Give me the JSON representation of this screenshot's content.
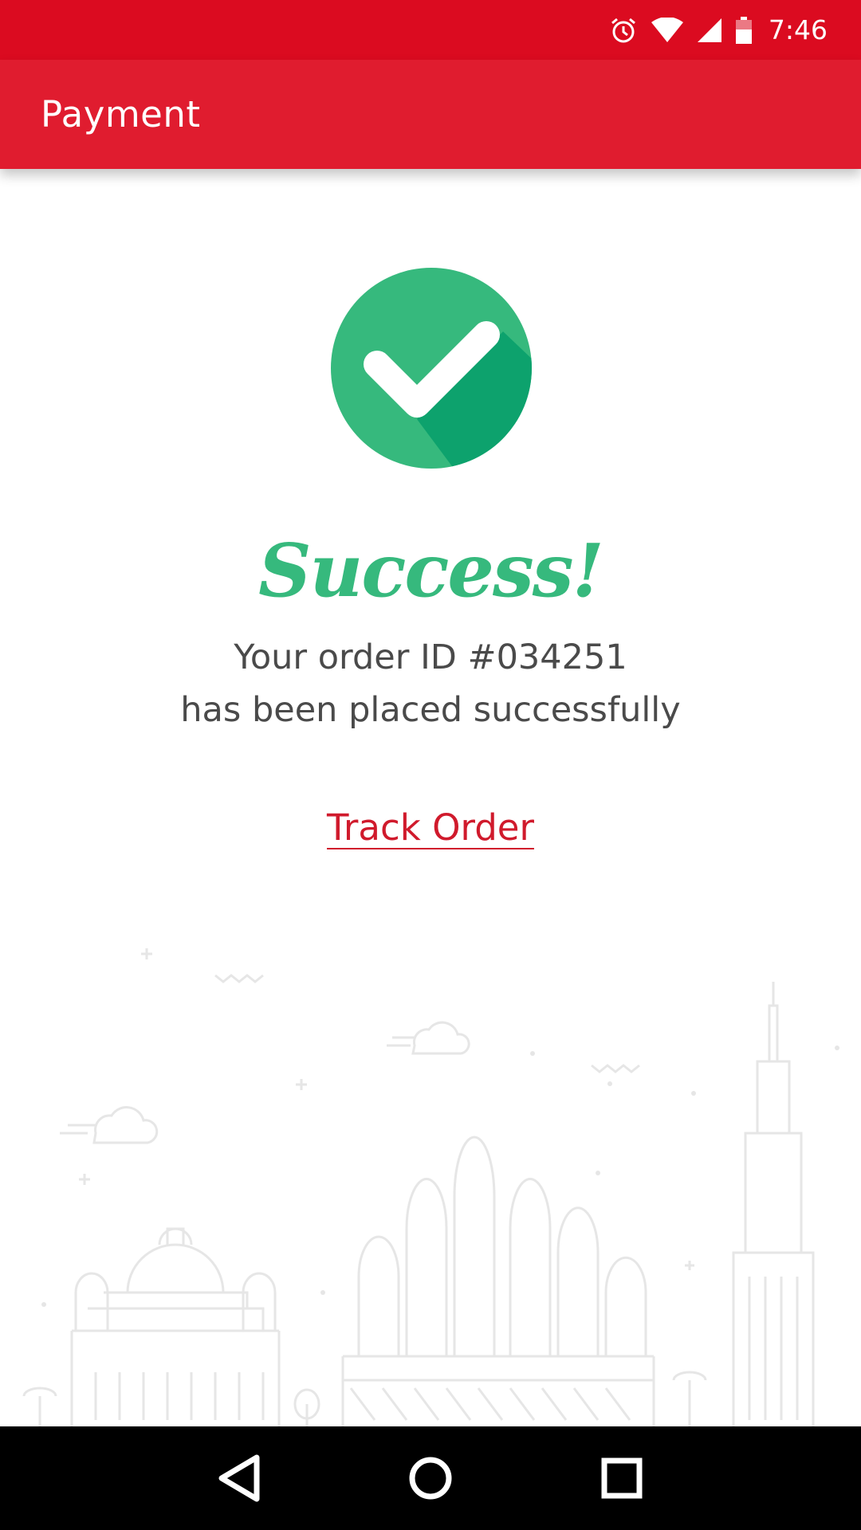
{
  "status_bar": {
    "time": "7:46",
    "icons": [
      "alarm-icon",
      "wifi-icon",
      "cell-signal-icon",
      "battery-icon"
    ]
  },
  "app_bar": {
    "title": "Payment"
  },
  "main": {
    "icon": "check-circle-icon",
    "heading": "Success!",
    "message_line1": "Your order ID #034251",
    "message_line2": "has been placed successfully",
    "track_link": "Track Order"
  },
  "nav_bar": {
    "buttons": [
      "back-icon",
      "home-icon",
      "recents-icon"
    ]
  },
  "colors": {
    "status_bar": "#db0b20",
    "app_bar": "#e01c2f",
    "success_green": "#36b97d",
    "success_green_dark": "#0da26d",
    "link_red": "#d01a2c",
    "text_gray": "#4a4a4a"
  }
}
